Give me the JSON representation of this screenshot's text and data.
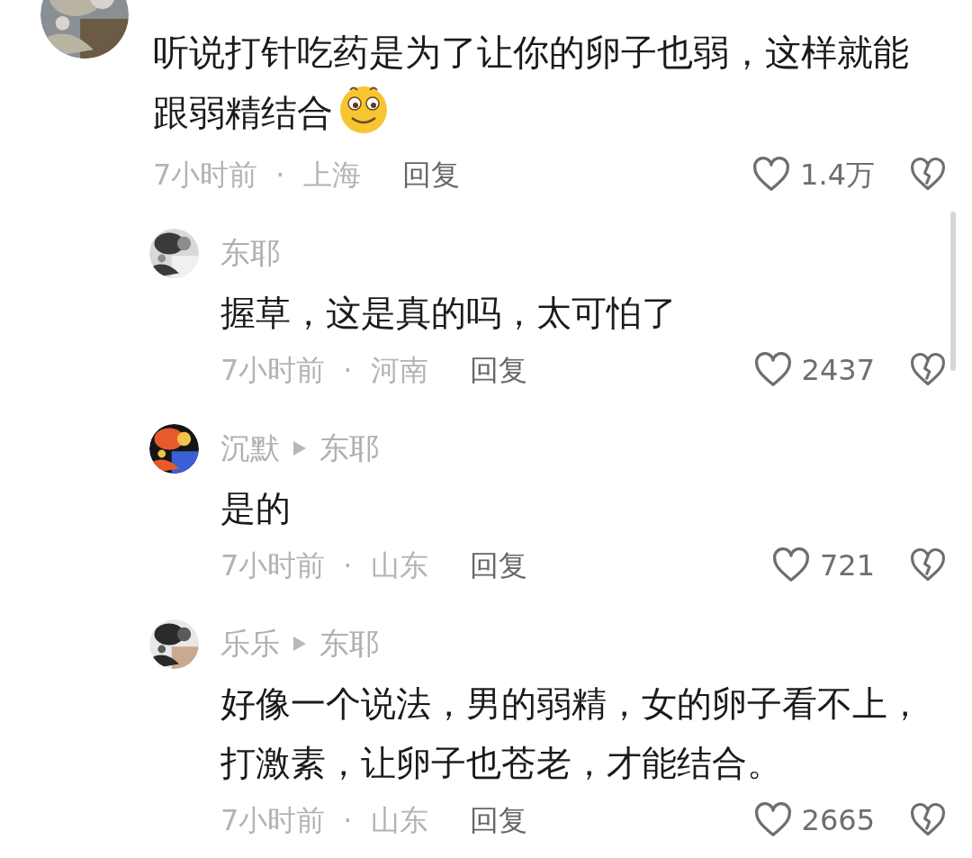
{
  "comments": [
    {
      "text": "听说打针吃药是为了让你的卵子也弱，这样就能跟弱精结合",
      "has_emoji": true,
      "time": "7小时前",
      "separator": "·",
      "location": "上海",
      "reply_label": "回复",
      "likes": "1.4万",
      "replies": [
        {
          "name": "东耶",
          "text": "握草，这是真的吗，太可怕了",
          "time": "7小时前",
          "separator": "·",
          "location": "河南",
          "reply_label": "回复",
          "likes": "2437"
        },
        {
          "name": "沉默",
          "reply_to": "东耶",
          "text": "是的",
          "time": "7小时前",
          "separator": "·",
          "location": "山东",
          "reply_label": "回复",
          "likes": "721"
        },
        {
          "name": "乐乐",
          "reply_to": "东耶",
          "text": "好像一个说法，男的弱精，女的卵子看不上，打激素，让卵子也苍老，才能结合。",
          "time": "7小时前",
          "separator": "·",
          "location": "山东",
          "reply_label": "回复",
          "likes": "2665"
        }
      ]
    }
  ]
}
